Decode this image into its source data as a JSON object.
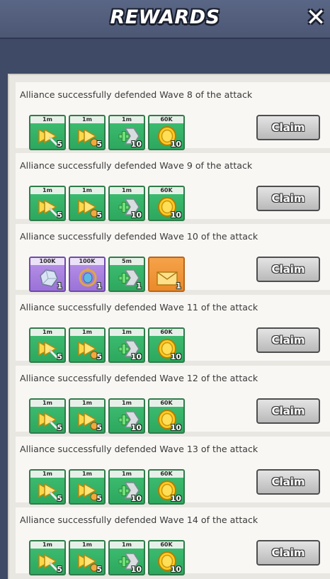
{
  "header": {
    "title": "REWARDS",
    "close_icon": "close-icon"
  },
  "claim_label": "Claim",
  "rewards": [
    {
      "text": "Alliance successfully defended Wave 8 of the attack",
      "items": [
        {
          "kind": "speedup-flag-icon",
          "badge": "1m",
          "qty": "5",
          "color": "green"
        },
        {
          "kind": "speedup-flag-gold-icon",
          "badge": "1m",
          "qty": "5",
          "color": "green"
        },
        {
          "kind": "speedup-arrow-icon",
          "badge": "1m",
          "qty": "10",
          "color": "green"
        },
        {
          "kind": "gold-coin-icon",
          "badge": "60K",
          "qty": "10",
          "color": "green"
        }
      ]
    },
    {
      "text": "Alliance successfully defended Wave 9 of the attack",
      "items": [
        {
          "kind": "speedup-flag-icon",
          "badge": "1m",
          "qty": "5",
          "color": "green"
        },
        {
          "kind": "speedup-flag-gold-icon",
          "badge": "1m",
          "qty": "5",
          "color": "green"
        },
        {
          "kind": "speedup-arrow-icon",
          "badge": "1m",
          "qty": "10",
          "color": "green"
        },
        {
          "kind": "gold-coin-icon",
          "badge": "60K",
          "qty": "10",
          "color": "green"
        }
      ]
    },
    {
      "text": "Alliance successfully defended Wave 10 of the attack",
      "items": [
        {
          "kind": "crystal-icon",
          "badge": "100K",
          "qty": "1",
          "color": "purple"
        },
        {
          "kind": "amulet-icon",
          "badge": "100K",
          "qty": "1",
          "color": "purple"
        },
        {
          "kind": "speedup-arrow-icon",
          "badge": "5m",
          "qty": "1",
          "color": "green"
        },
        {
          "kind": "envelope-icon",
          "badge": "",
          "qty": "1",
          "color": "orange"
        }
      ]
    },
    {
      "text": "Alliance successfully defended Wave 11 of the attack",
      "items": [
        {
          "kind": "speedup-flag-icon",
          "badge": "1m",
          "qty": "5",
          "color": "green"
        },
        {
          "kind": "speedup-flag-gold-icon",
          "badge": "1m",
          "qty": "5",
          "color": "green"
        },
        {
          "kind": "speedup-arrow-icon",
          "badge": "1m",
          "qty": "10",
          "color": "green"
        },
        {
          "kind": "gold-coin-icon",
          "badge": "60K",
          "qty": "10",
          "color": "green"
        }
      ]
    },
    {
      "text": "Alliance successfully defended Wave 12 of the attack",
      "items": [
        {
          "kind": "speedup-flag-icon",
          "badge": "1m",
          "qty": "5",
          "color": "green"
        },
        {
          "kind": "speedup-flag-gold-icon",
          "badge": "1m",
          "qty": "5",
          "color": "green"
        },
        {
          "kind": "speedup-arrow-icon",
          "badge": "1m",
          "qty": "10",
          "color": "green"
        },
        {
          "kind": "gold-coin-icon",
          "badge": "60K",
          "qty": "10",
          "color": "green"
        }
      ]
    },
    {
      "text": "Alliance successfully defended Wave 13 of the attack",
      "items": [
        {
          "kind": "speedup-flag-icon",
          "badge": "1m",
          "qty": "5",
          "color": "green"
        },
        {
          "kind": "speedup-flag-gold-icon",
          "badge": "1m",
          "qty": "5",
          "color": "green"
        },
        {
          "kind": "speedup-arrow-icon",
          "badge": "1m",
          "qty": "10",
          "color": "green"
        },
        {
          "kind": "gold-coin-icon",
          "badge": "60K",
          "qty": "10",
          "color": "green"
        }
      ]
    },
    {
      "text": "Alliance successfully defended Wave 14 of the attack",
      "items": [
        {
          "kind": "speedup-flag-icon",
          "badge": "1m",
          "qty": "5",
          "color": "green"
        },
        {
          "kind": "speedup-flag-gold-icon",
          "badge": "1m",
          "qty": "5",
          "color": "green"
        },
        {
          "kind": "speedup-arrow-icon",
          "badge": "1m",
          "qty": "10",
          "color": "green"
        },
        {
          "kind": "gold-coin-icon",
          "badge": "60K",
          "qty": "10",
          "color": "green"
        }
      ]
    }
  ]
}
